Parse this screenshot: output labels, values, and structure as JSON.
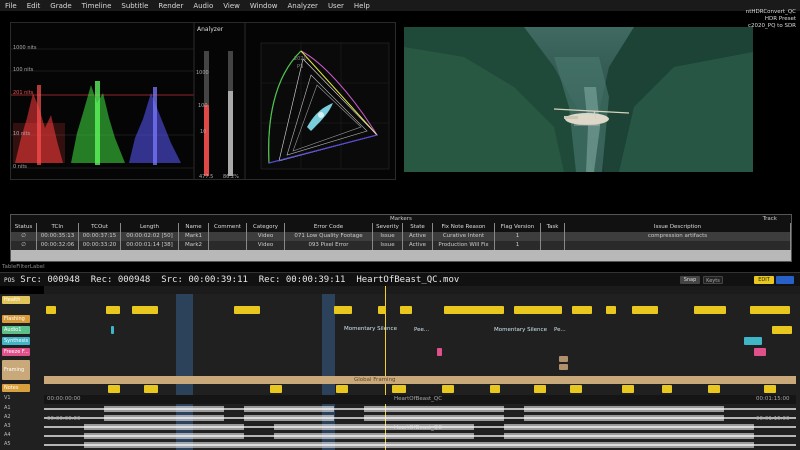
{
  "menubar": [
    "File",
    "Edit",
    "Grade",
    "Timeline",
    "Subtitle",
    "Render",
    "Audio",
    "View",
    "Window",
    "Analyzer",
    "User",
    "Help"
  ],
  "preset_info": [
    "ntHDRConvert_QC",
    "HDR Preset",
    "c2020_PQ to SDR"
  ],
  "scope": {
    "title": "Analyzer",
    "nits_labels": [
      "1000 nits",
      "100 nits",
      "201 nits",
      "10 nits",
      "0 nits"
    ],
    "meter_ticks": [
      "1000",
      "100",
      "10"
    ],
    "meter_values": [
      "477.5",
      "86.2%"
    ],
    "gamut_labels": [
      "2020",
      "P3"
    ]
  },
  "markers": {
    "title": "Markers",
    "track_label": "Track",
    "headers": [
      "Status",
      "TCIn",
      "TCOut",
      "Length",
      "Name",
      "Comment",
      "Category",
      "Error Code",
      "Severity",
      "State",
      "Fix Note Reason",
      "Flag Version",
      "Task",
      "Issue Description"
    ],
    "rows": [
      [
        "∅",
        "00:00:35:13",
        "00:00:37:15",
        "00:00:02:02 [50]",
        "Mark1",
        "",
        "Video",
        "071 Low Quality Footage",
        "Issue",
        "Active",
        "Curative Intent",
        "1",
        "",
        "compression artifacts"
      ],
      [
        "∅",
        "00:00:32:06",
        "00:00:33:20",
        "00:00:01:14 [38]",
        "Mark2",
        "",
        "Video",
        "093 Pixel Error",
        "Issue",
        "Active",
        "Production Will Fix",
        "1",
        "",
        ""
      ]
    ]
  },
  "table_filter_label": "TableFilterLabel",
  "timeline": {
    "status_prefix": "POS",
    "src1_label": "Src:",
    "src1_value": "000948",
    "rec1_label": "Rec:",
    "rec1_value": "000948",
    "src2_label": "Src:",
    "src2_value": "00:00:39:11",
    "rec2_label": "Rec:",
    "rec2_value": "00:00:39:11",
    "filename": "HeartOfBeast_QC.mov",
    "snap_label": "Snap",
    "keyed_label": "Keyts",
    "edit_label": "EDIT",
    "track_labels": [
      "Health",
      "Flashing",
      "Audio1",
      "Synthesis",
      "Freeze F...",
      "Framing",
      "Notes",
      "V1",
      "A1",
      "A2",
      "A3",
      "A4",
      "A5"
    ],
    "marker_texts": [
      "Momentary Silence",
      "Pee...",
      "Momentary Silence",
      "Pe...",
      "Global Framing"
    ],
    "v1_left_tc": "00:00:00:00",
    "v1_center": "HeartOfBeast_QC",
    "v1_right_tc": "00:01:15:00",
    "a_left_tc": "00:00:00:00",
    "a_center": "HeartOfBeast_QC",
    "a_right_tc": "00:01:15:00"
  },
  "colors": {
    "yellow": "#e8c81f",
    "health": "#e2c55a",
    "flashing": "#d99a3a",
    "audio": "#5bc08a",
    "synthesis": "#3fb5c7",
    "freeze": "#e0508a",
    "framing": "#c9a97a",
    "notes": "#d9a13e",
    "playhead": "#f0d020"
  }
}
